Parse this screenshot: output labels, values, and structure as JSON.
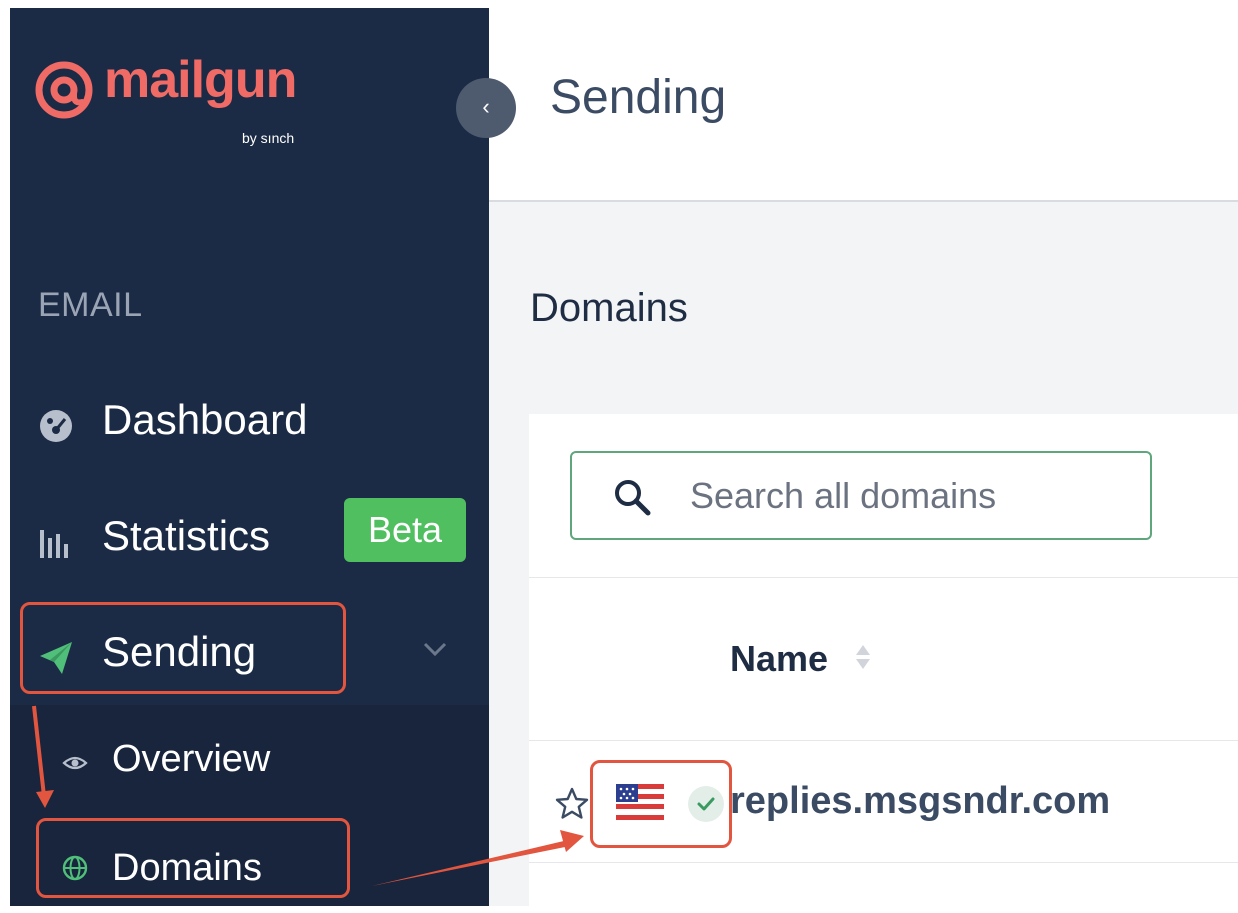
{
  "brand": {
    "name": "mailgun",
    "sub": "by sınch",
    "color": "#f06b66"
  },
  "sidebar": {
    "collapse_icon": "chevron-left-icon",
    "section_label": "EMAIL",
    "items": [
      {
        "label": "Dashboard",
        "icon": "dashboard-icon"
      },
      {
        "label": "Statistics",
        "icon": "bar-chart-icon",
        "badge": "Beta"
      },
      {
        "label": "Sending",
        "icon": "paper-plane-icon",
        "expanded": true
      }
    ],
    "sub_items": [
      {
        "label": "Overview",
        "icon": "eye-icon"
      },
      {
        "label": "Domains",
        "icon": "globe-icon"
      }
    ],
    "background": "#1c2b45",
    "badge_color": "#4fbf60"
  },
  "header": {
    "title": "Sending"
  },
  "main": {
    "section_title": "Domains",
    "search": {
      "placeholder": "Search all domains",
      "value": ""
    },
    "table": {
      "columns": [
        "Name"
      ],
      "rows": [
        {
          "name": "replies.msgsndr.com",
          "region": "US",
          "verified": true,
          "starred": false
        }
      ]
    }
  },
  "annotation": {
    "color": "#e2553f"
  }
}
